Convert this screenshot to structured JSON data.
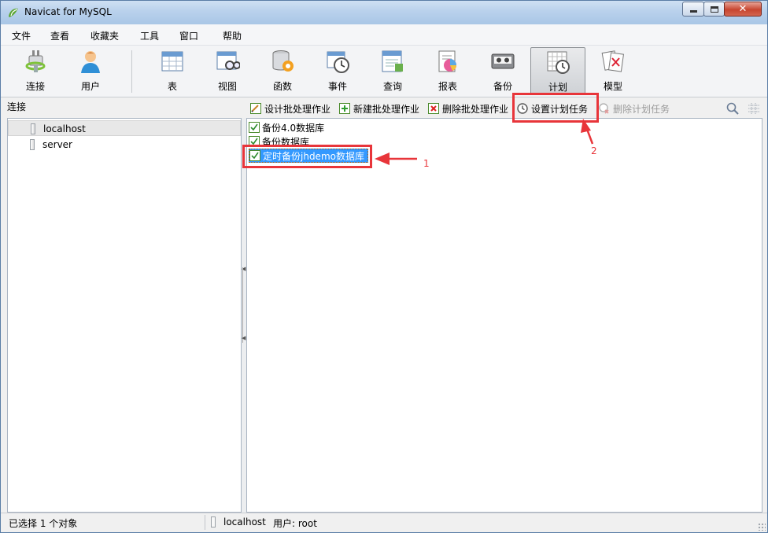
{
  "window": {
    "title": "Navicat for MySQL"
  },
  "menu": {
    "items": [
      "文件",
      "查看",
      "收藏夹",
      "工具",
      "窗口",
      "帮助"
    ]
  },
  "toolbar": {
    "connect": "连接",
    "user": "用户",
    "table": "表",
    "view": "视图",
    "function": "函数",
    "event": "事件",
    "query": "查询",
    "report": "报表",
    "backup": "备份",
    "schedule": "计划",
    "model": "模型",
    "active": "计划"
  },
  "left_pane": {
    "header": "连接",
    "items": [
      {
        "label": "localhost",
        "selected": true
      },
      {
        "label": "server",
        "selected": false
      }
    ]
  },
  "object_toolbar": {
    "design_batch": "设计批处理作业",
    "new_batch": "新建批处理作业",
    "delete_batch": "删除批处理作业",
    "set_schedule": "设置计划任务",
    "delete_schedule": "删除计划任务"
  },
  "right_pane": {
    "items": [
      {
        "label": "备份4.0数据库",
        "selected": false
      },
      {
        "label": "备份数据库",
        "selected": false
      },
      {
        "label": "定时备份jhdemo数据库",
        "selected": true
      }
    ]
  },
  "annotations": {
    "one": "1",
    "two": "2",
    "color": "#e8353a"
  },
  "status": {
    "selection": "已选择 1 个对象",
    "host": "localhost",
    "user": "用户: root"
  }
}
